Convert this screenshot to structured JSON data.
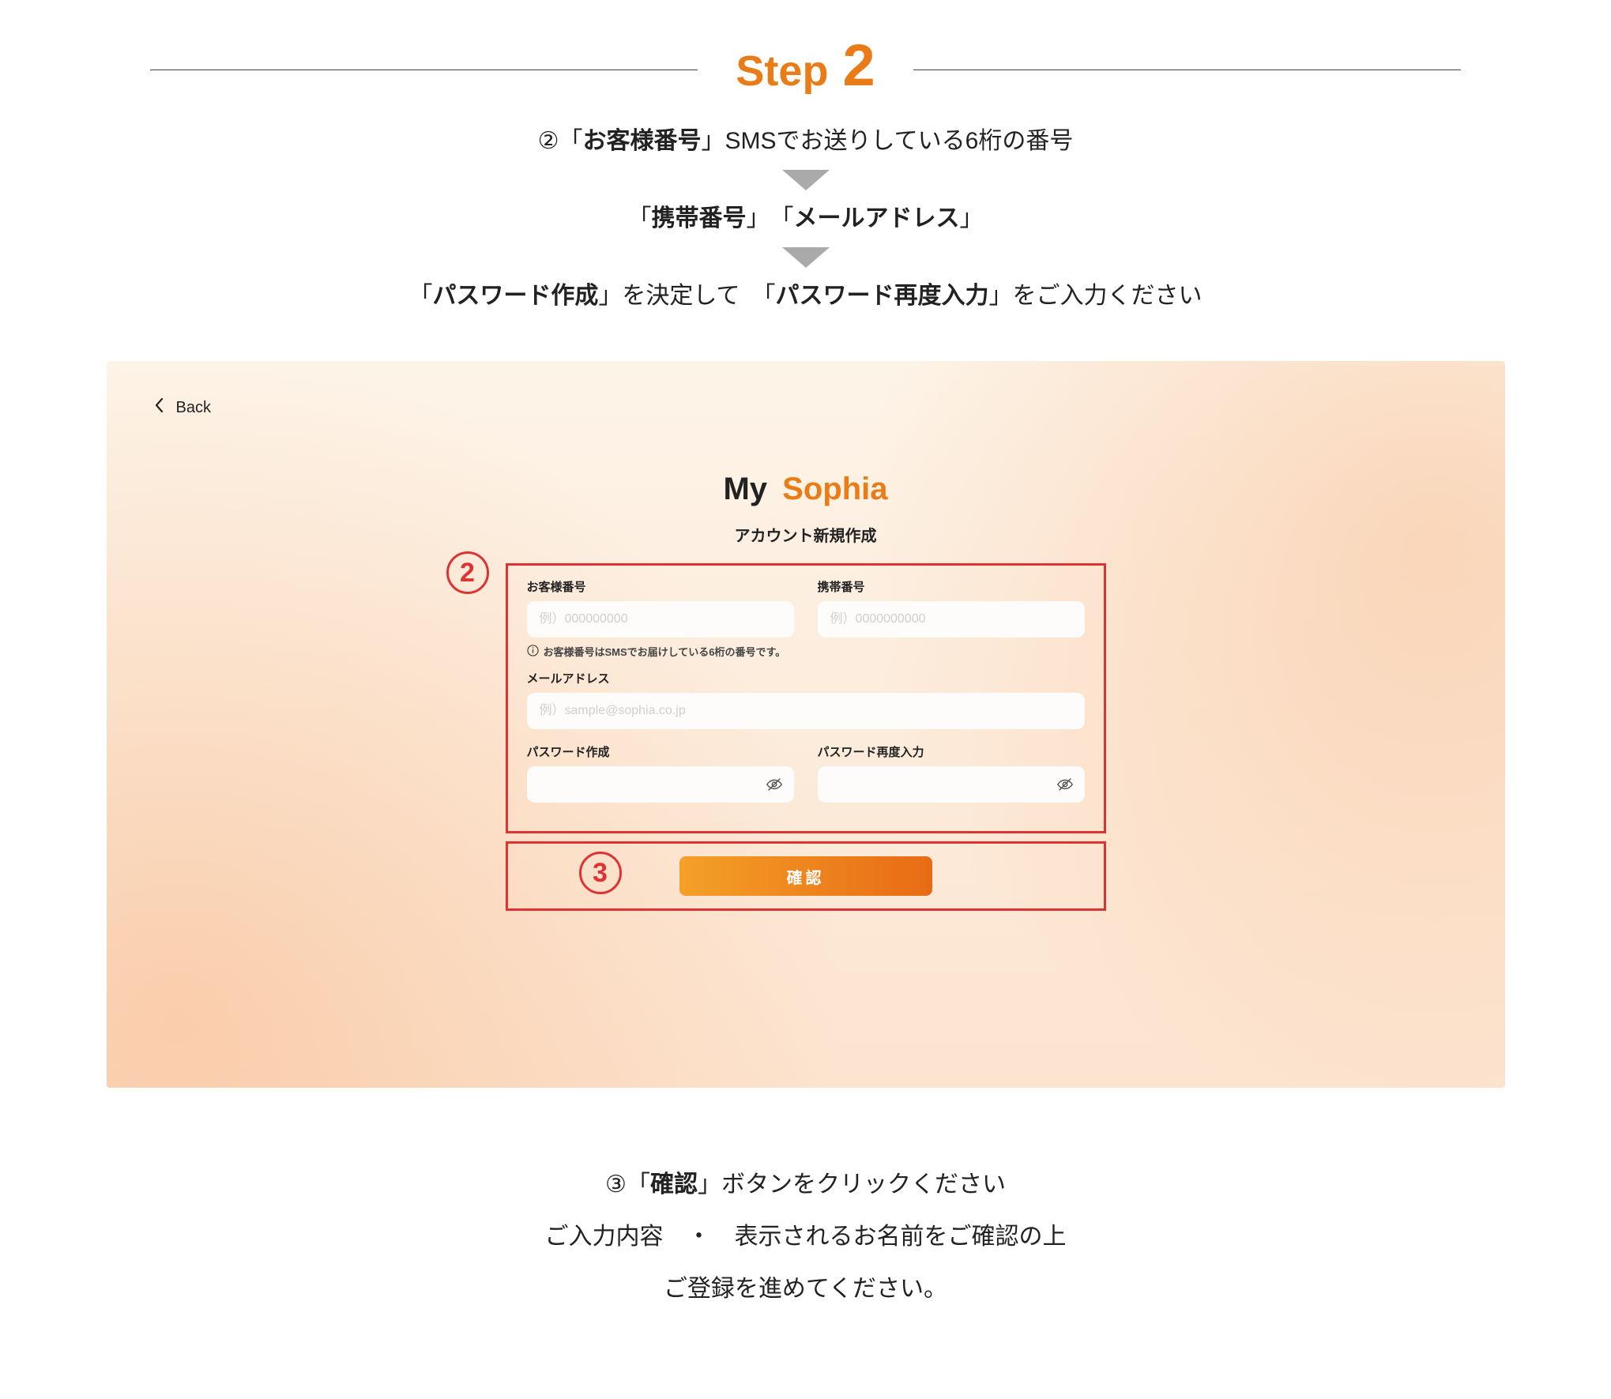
{
  "step": {
    "word": "Step",
    "num": "2"
  },
  "instructions": {
    "line1_prefix": "②「",
    "line1_bold": "お客様番号",
    "line1_suffix": "」SMSでお送りしている6桁の番号",
    "line2_a_prefix": "「",
    "line2_a_bold": "携帯番号",
    "line2_a_suffix": "」　「",
    "line2_b_bold": "メールアドレス",
    "line2_b_suffix": "」",
    "line3_a_prefix": "「",
    "line3_a_bold": "パスワード作成",
    "line3_a_suffix": "」を決定して　「",
    "line3_b_bold": "パスワード再度入力",
    "line3_b_suffix": "」をご入力ください"
  },
  "screenshot": {
    "back": "Back",
    "brand_my": "My",
    "brand_sophia": "Sophia",
    "subtitle": "アカウント新規作成",
    "callout2": "2",
    "callout3": "3",
    "fields": {
      "customer_label": "お客様番号",
      "customer_ph": "例）000000000",
      "phone_label": "携帯番号",
      "phone_ph": "例）0000000000",
      "hint": "お客様番号はSMSでお届けしている6桁の番号です。",
      "email_label": "メールアドレス",
      "email_ph": "例）sample@sophia.co.jp",
      "pw1_label": "パスワード作成",
      "pw2_label": "パスワード再度入力"
    },
    "confirm": "確認"
  },
  "footer": {
    "line1_prefix": "③「",
    "line1_bold": "確認",
    "line1_suffix": "」ボタンをクリックください",
    "line2": "ご入力内容　・　表示されるお名前をご確認の上",
    "line3": "ご登録を進めてください。"
  }
}
